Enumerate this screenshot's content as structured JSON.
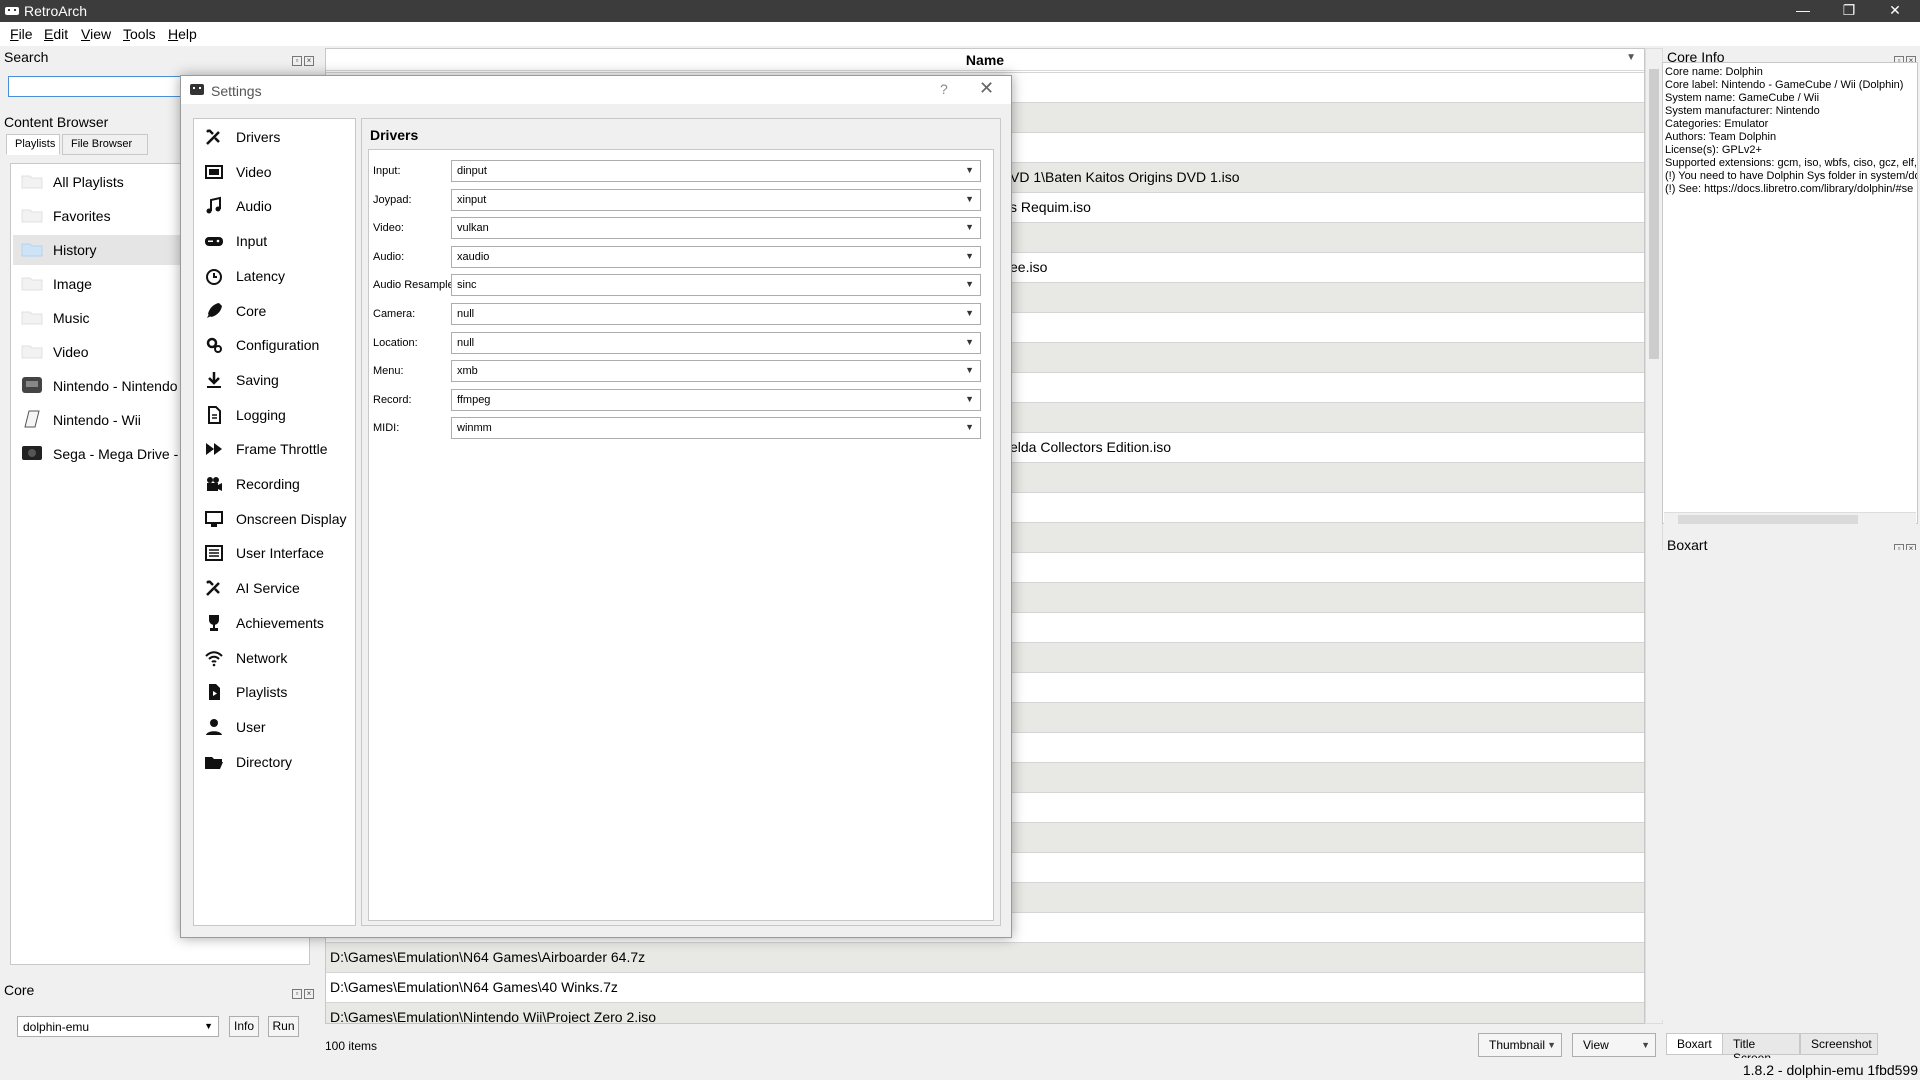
{
  "window": {
    "title": "RetroArch",
    "minimize": "—",
    "restore": "❐",
    "close": "✕"
  },
  "menubar": [
    {
      "pre": "",
      "u": "F",
      "post": "ile"
    },
    {
      "pre": "",
      "u": "E",
      "post": "dit"
    },
    {
      "pre": "",
      "u": "V",
      "post": "iew"
    },
    {
      "pre": "",
      "u": "T",
      "post": "ools"
    },
    {
      "pre": "",
      "u": "H",
      "post": "elp"
    }
  ],
  "search": {
    "title": "Search",
    "value": ""
  },
  "content_browser": {
    "title": "Content Browser",
    "tabs": [
      "Playlists",
      "File Browser"
    ],
    "items": [
      {
        "label": "All Playlists",
        "icon": "folder-icon"
      },
      {
        "label": "Favorites",
        "icon": "folder-icon"
      },
      {
        "label": "History",
        "icon": "folder-icon",
        "selected": true
      },
      {
        "label": "Image",
        "icon": "folder-icon"
      },
      {
        "label": "Music",
        "icon": "folder-icon"
      },
      {
        "label": "Video",
        "icon": "folder-icon"
      },
      {
        "label": "Nintendo - Nintendo",
        "icon": "console-icon"
      },
      {
        "label": "Nintendo - Wii",
        "icon": "console-icon"
      },
      {
        "label": "Sega - Mega Drive -",
        "icon": "console-icon"
      }
    ]
  },
  "core": {
    "title": "Core",
    "selected": "dolphin-emu",
    "info_label": "Info",
    "run_label": "Run"
  },
  "table": {
    "header": "Name",
    "rows": [
      "",
      "",
      "",
      "VD 1\\Baten Kaitos Origins DVD 1.iso",
      "s Requim.iso",
      "",
      "ee.iso",
      "",
      "",
      "",
      "",
      "",
      "elda Collectors Edition.iso",
      "",
      "",
      "",
      "",
      "",
      "",
      "",
      "",
      "",
      "",
      "",
      "",
      "",
      "",
      "",
      "",
      "D:\\Games\\Emulation\\N64 Games\\Airboarder 64.7z",
      "D:\\Games\\Emulation\\N64 Games\\40 Winks.7z",
      "D:\\Games\\Emulation\\Nintendo Wii\\Project Zero 2.iso"
    ],
    "items_count": "100 items"
  },
  "bottom": {
    "thumbnail": "Thumbnail",
    "view": "View",
    "tabs": [
      "Boxart",
      "Title Screen",
      "Screenshot"
    ]
  },
  "status": {
    "version": "1.8.2 - dolphin-emu 1fbd599"
  },
  "core_info": {
    "title": "Core Info",
    "lines": [
      "Core name: Dolphin",
      "Core label: Nintendo - GameCube / Wii (Dolphin)",
      "System name: GameCube / Wii",
      "System manufacturer: Nintendo",
      "Categories: Emulator",
      "Authors: Team Dolphin",
      "License(s): GPLv2+",
      "Supported extensions: gcm, iso, wbfs, ciso, gcz, elf,",
      "(!) You need to have Dolphin Sys folder in system/do",
      "(!) See: https://docs.libretro.com/library/dolphin/#se"
    ]
  },
  "boxart": {
    "title": "Boxart"
  },
  "settings": {
    "title": "Settings",
    "help": "?",
    "close": "✕",
    "panel_title": "Drivers",
    "categories": [
      {
        "label": "Drivers",
        "icon": "tools-icon"
      },
      {
        "label": "Video",
        "icon": "video-icon"
      },
      {
        "label": "Audio",
        "icon": "music-note-icon"
      },
      {
        "label": "Input",
        "icon": "gamepad-icon"
      },
      {
        "label": "Latency",
        "icon": "clock-icon"
      },
      {
        "label": "Core",
        "icon": "rocket-icon"
      },
      {
        "label": "Configuration",
        "icon": "gears-icon"
      },
      {
        "label": "Saving",
        "icon": "download-icon"
      },
      {
        "label": "Logging",
        "icon": "document-icon"
      },
      {
        "label": "Frame Throttle",
        "icon": "fast-forward-icon"
      },
      {
        "label": "Recording",
        "icon": "camera-icon"
      },
      {
        "label": "Onscreen Display",
        "icon": "monitor-icon"
      },
      {
        "label": "User Interface",
        "icon": "list-icon"
      },
      {
        "label": "AI Service",
        "icon": "tools-icon"
      },
      {
        "label": "Achievements",
        "icon": "trophy-icon"
      },
      {
        "label": "Network",
        "icon": "wifi-icon"
      },
      {
        "label": "Playlists",
        "icon": "playlist-icon"
      },
      {
        "label": "User",
        "icon": "user-icon"
      },
      {
        "label": "Directory",
        "icon": "folder-open-icon"
      }
    ],
    "drivers": [
      {
        "label": "Input:",
        "value": "dinput"
      },
      {
        "label": "Joypad:",
        "value": "xinput"
      },
      {
        "label": "Video:",
        "value": "vulkan"
      },
      {
        "label": "Audio:",
        "value": "xaudio"
      },
      {
        "label": "Audio Resampler:",
        "value": "sinc"
      },
      {
        "label": "Camera:",
        "value": "null"
      },
      {
        "label": "Location:",
        "value": "null"
      },
      {
        "label": "Menu:",
        "value": "xmb"
      },
      {
        "label": "Record:",
        "value": "ffmpeg"
      },
      {
        "label": "MIDI:",
        "value": "winmm"
      }
    ]
  }
}
